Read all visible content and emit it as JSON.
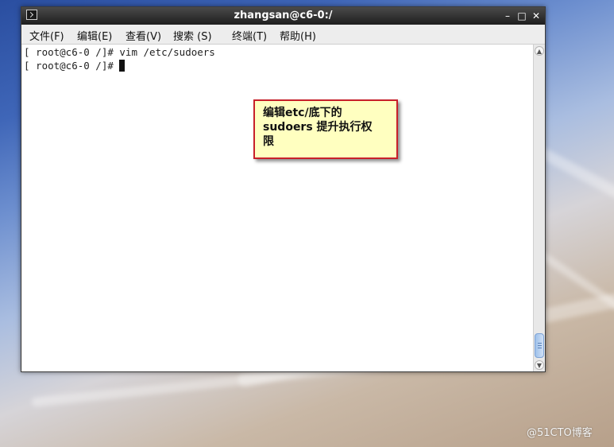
{
  "window": {
    "title": "zhangsan@c6-0:/",
    "controls": {
      "minimize": "–",
      "maximize": "□",
      "close": "✕"
    }
  },
  "menu": {
    "items": [
      {
        "label": "文件(F)"
      },
      {
        "label": "编辑(E)"
      },
      {
        "label": "查看(V)"
      },
      {
        "label": "搜索 (S)"
      },
      {
        "label": "终端(T)"
      },
      {
        "label": "帮助(H)"
      }
    ]
  },
  "terminal": {
    "lines": [
      {
        "text": "[ root@c6-0 /]# vim /etc/sudoers"
      },
      {
        "text": "[ root@c6-0 /]# "
      }
    ]
  },
  "annotation": {
    "lines": [
      "编辑etc/底下的",
      "sudoers 提升执行权",
      "限"
    ]
  },
  "watermark": {
    "text": "@51CTO博客"
  },
  "icons": {
    "window": "terminal-icon",
    "scroll_up": "scroll-up-arrow-icon",
    "scroll_down": "scroll-down-arrow-icon"
  },
  "colors": {
    "callout_border": "#c8202a",
    "callout_fill": "#ffffc0",
    "titlebar": "#2a2a2a"
  }
}
